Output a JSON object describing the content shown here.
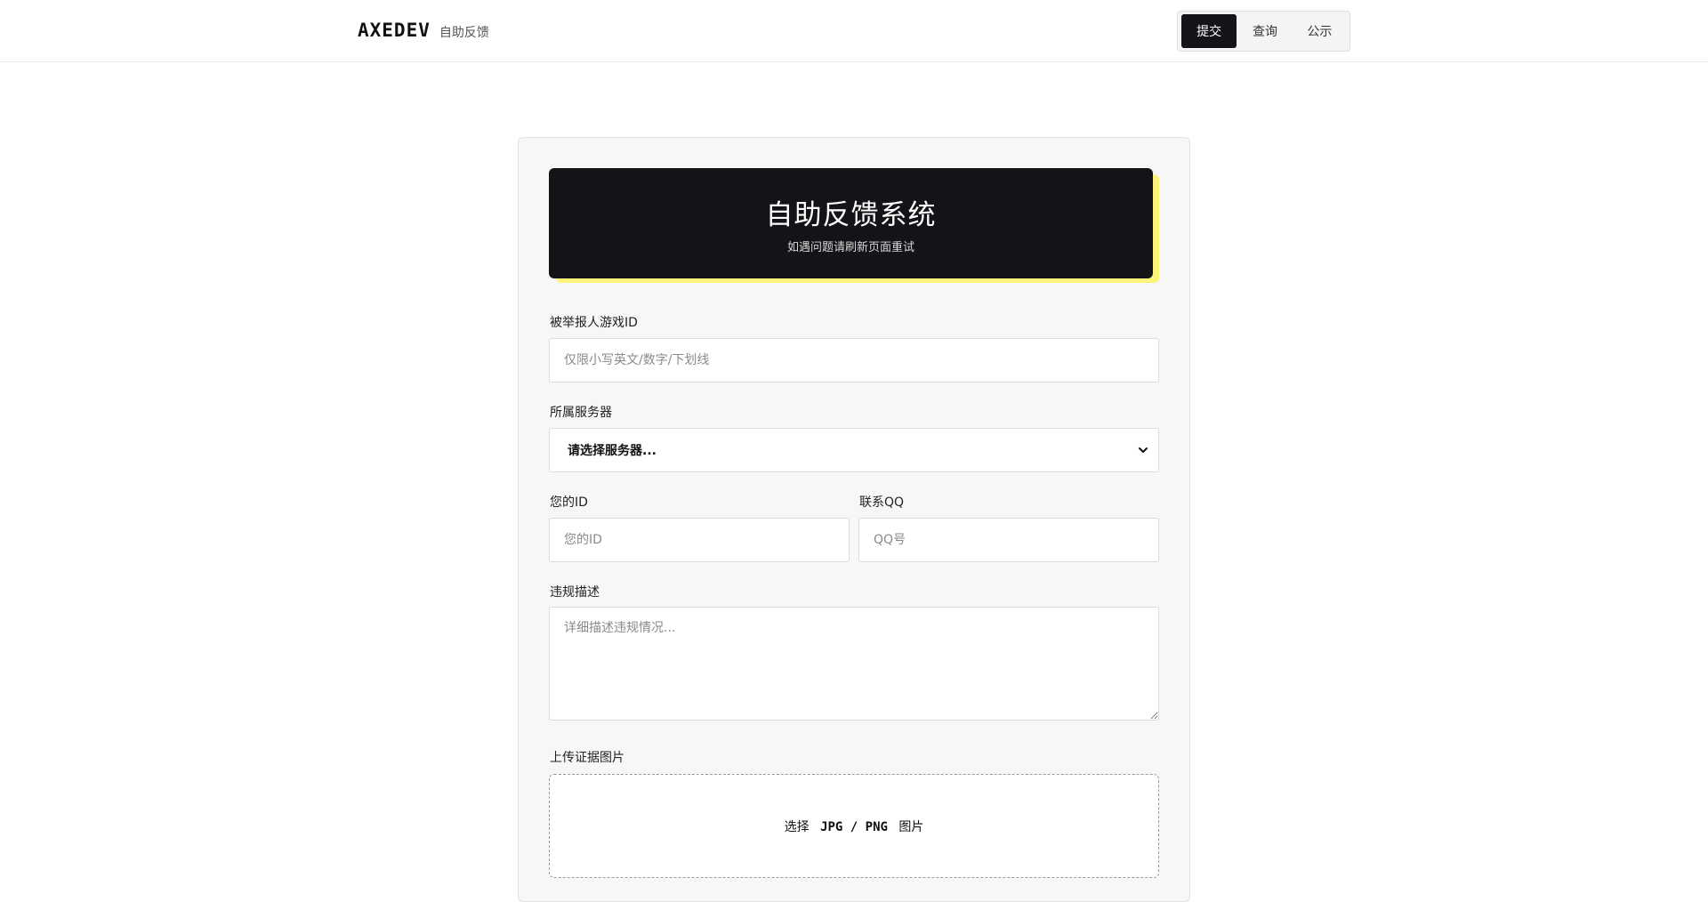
{
  "header": {
    "logo": "AXEDEV",
    "subtitle": "自助反馈",
    "tabs": [
      {
        "label": "提交",
        "active": true
      },
      {
        "label": "查询",
        "active": false
      },
      {
        "label": "公示",
        "active": false
      }
    ]
  },
  "hero": {
    "title": "自助反馈系统",
    "subtitle": "如遇问题请刷新页面重试"
  },
  "form": {
    "reported_id": {
      "label": "被举报人游戏ID",
      "placeholder": "仅限小写英文/数字/下划线",
      "value": ""
    },
    "server": {
      "label": "所属服务器",
      "selected": "请选择服务器..."
    },
    "your_id": {
      "label": "您的ID",
      "placeholder": "您的ID",
      "value": ""
    },
    "qq": {
      "label": "联系QQ",
      "placeholder": "QQ号",
      "value": ""
    },
    "description": {
      "label": "违规描述",
      "placeholder": "详细描述违规情况...",
      "value": ""
    },
    "evidence": {
      "label": "上传证据图片",
      "prefix": "选择",
      "formats": "JPG / PNG",
      "suffix": "图片"
    }
  },
  "colors": {
    "dark": "#131417",
    "accent_shadow": "#fbf37a",
    "card_bg": "#f7f7f7"
  }
}
